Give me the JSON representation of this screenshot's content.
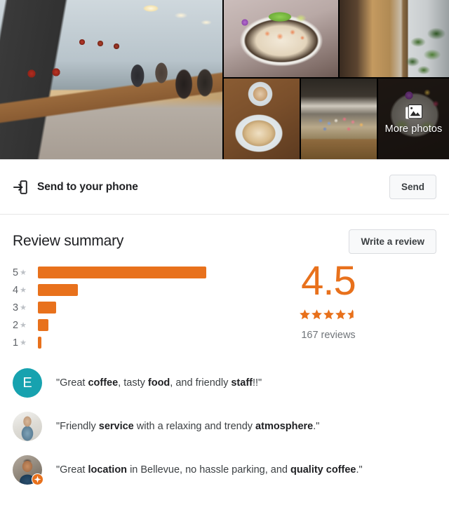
{
  "gallery": {
    "tiles": [
      {
        "name": "cafe-interior-photo",
        "alt": "Cafe interior with communal wood table and windows"
      },
      {
        "name": "salmon-bagel-photo",
        "alt": "Smoked salmon bagel on white plate"
      },
      {
        "name": "window-plant-photo",
        "alt": "Plant by the window seating"
      },
      {
        "name": "latte-art-photo",
        "alt": "Two lattes with latte art"
      },
      {
        "name": "pastry-case-photo",
        "alt": "Colorful macarons in a pastry case"
      },
      {
        "name": "more-photos-tile",
        "alt": "Avocado toast plate"
      }
    ],
    "more_photos_label": "More photos",
    "more_photos_icon": "photos-stack-icon"
  },
  "send_to_phone": {
    "icon": "send-to-device-icon",
    "label": "Send to your phone",
    "button_label": "Send"
  },
  "review_summary": {
    "title": "Review summary",
    "write_review_label": "Write a review",
    "score": "4.5",
    "stars_filled": 4,
    "stars_half": true,
    "stars_total": 5,
    "reviews_count_label": "167 reviews",
    "accent_color": "#e8711c"
  },
  "chart_data": {
    "type": "bar",
    "orientation": "horizontal",
    "title": "Review summary",
    "xlabel": "",
    "ylabel": "",
    "categories": [
      "5",
      "4",
      "3",
      "2",
      "1"
    ],
    "category_suffix": "★",
    "values": [
      240,
      57,
      26,
      15,
      5
    ],
    "value_unit": "px-width",
    "max_value": 240,
    "bar_color": "#e8711c",
    "grid": false,
    "legend": false,
    "aggregate_rating": 4.5,
    "total_reviews": 167
  },
  "snippets": [
    {
      "avatar_type": "letter",
      "avatar_letter": "E",
      "avatar_color": "#17a2af",
      "badge": false,
      "parts": [
        {
          "text": "\"Great ",
          "bold": false
        },
        {
          "text": "coffee",
          "bold": true
        },
        {
          "text": ", tasty ",
          "bold": false
        },
        {
          "text": "food",
          "bold": true
        },
        {
          "text": ", and friendly ",
          "bold": false
        },
        {
          "text": "staff",
          "bold": true
        },
        {
          "text": "!!\"",
          "bold": false
        }
      ]
    },
    {
      "avatar_type": "photo-a",
      "avatar_letter": "",
      "badge": false,
      "parts": [
        {
          "text": "\"Friendly ",
          "bold": false
        },
        {
          "text": "service",
          "bold": true
        },
        {
          "text": " with a relaxing and trendy ",
          "bold": false
        },
        {
          "text": "atmosphere",
          "bold": true
        },
        {
          "text": ".\"",
          "bold": false
        }
      ]
    },
    {
      "avatar_type": "photo-b",
      "avatar_letter": "",
      "badge": true,
      "badge_name": "local-guide-badge",
      "parts": [
        {
          "text": "\"Great ",
          "bold": false
        },
        {
          "text": "location",
          "bold": true
        },
        {
          "text": " in Bellevue, no hassle parking, and ",
          "bold": false
        },
        {
          "text": "quality coffee",
          "bold": true
        },
        {
          "text": ".\"",
          "bold": false
        }
      ]
    }
  ]
}
